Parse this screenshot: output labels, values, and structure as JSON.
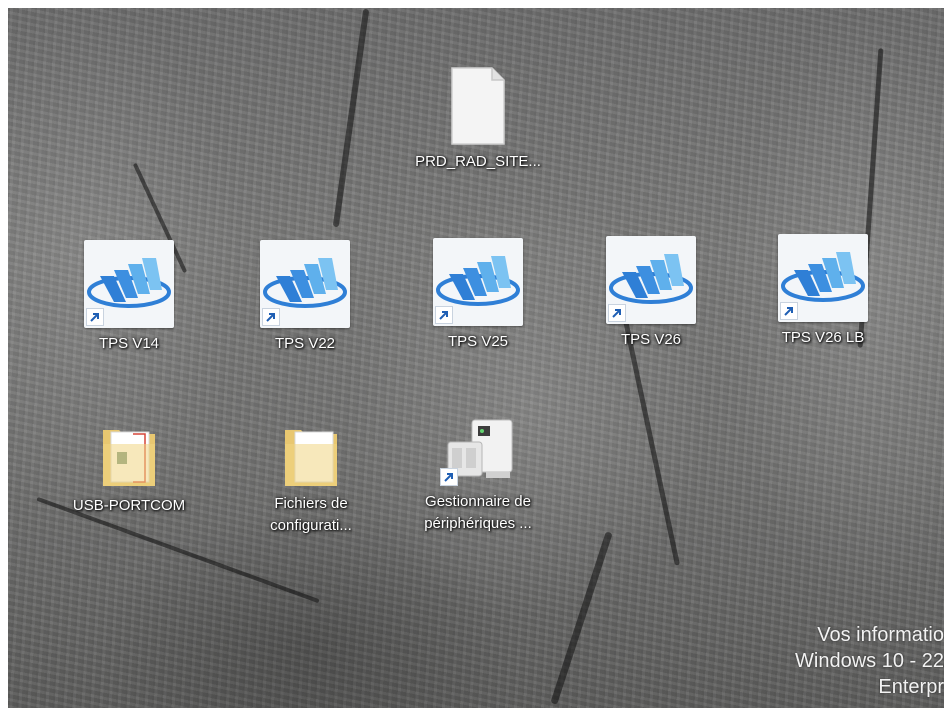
{
  "desktop": {
    "icons": [
      {
        "label": "PRD_RAD_SITE...",
        "icon": "blank-document-icon"
      },
      {
        "label": "TPS V14",
        "icon": "tps-app-icon",
        "shortcut": true
      },
      {
        "label": "TPS V22",
        "icon": "tps-app-icon",
        "shortcut": true
      },
      {
        "label": "TPS V25",
        "icon": "tps-app-icon",
        "shortcut": true
      },
      {
        "label": "TPS V26",
        "icon": "tps-app-icon",
        "shortcut": true
      },
      {
        "label": "TPS V26 LB",
        "icon": "tps-app-icon",
        "shortcut": true
      },
      {
        "label": "USB-PORTCOM",
        "icon": "folder-icon"
      },
      {
        "label_line1": "Fichiers de",
        "label_line2": "configurati...",
        "icon": "folder-icon"
      },
      {
        "label_line1": "Gestionnaire de",
        "label_line2": "périphériques ...",
        "icon": "device-manager-icon",
        "shortcut": true
      }
    ]
  },
  "watermark": {
    "line1": "Vos informatio",
    "line2": "Windows 10 - 22",
    "line3": "Enterpr"
  },
  "colors": {
    "tps_blue": "#2f7fd6",
    "tps_light_blue": "#5fb0ec",
    "label_text": "#ffffff"
  }
}
